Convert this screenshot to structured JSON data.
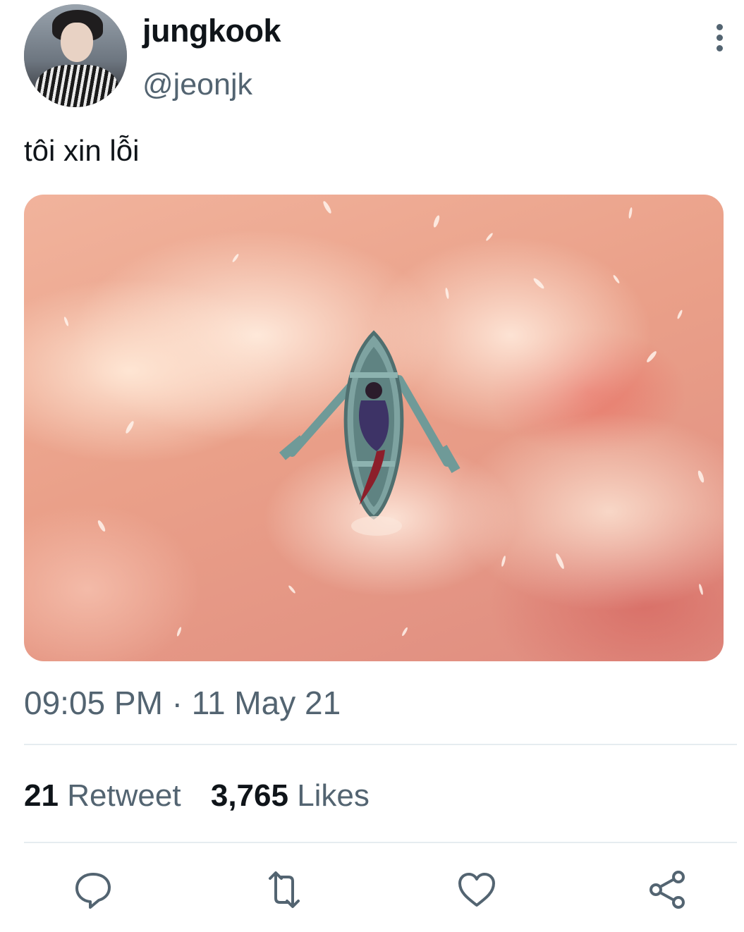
{
  "user": {
    "display_name": "jungkook",
    "handle": "@jeonjk",
    "avatar_icon": "avatar-photo"
  },
  "tweet": {
    "text": "tôi xin lỗi",
    "media_icon": "illustration-boat-in-pink-clouds",
    "timestamp": "09:05 PM · 11 May 21"
  },
  "stats": {
    "retweets_count": "21",
    "retweets_label": "Retweet",
    "likes_count": "3,765",
    "likes_label": "Likes"
  },
  "actions": [
    {
      "name": "reply",
      "icon": "comment-icon"
    },
    {
      "name": "retweet",
      "icon": "retweet-icon"
    },
    {
      "name": "like",
      "icon": "heart-icon"
    },
    {
      "name": "share",
      "icon": "share-icon"
    }
  ],
  "colors": {
    "text_primary": "#0f1419",
    "text_secondary": "#536471",
    "icon": "#536471",
    "divider": "#e6ecf0"
  }
}
